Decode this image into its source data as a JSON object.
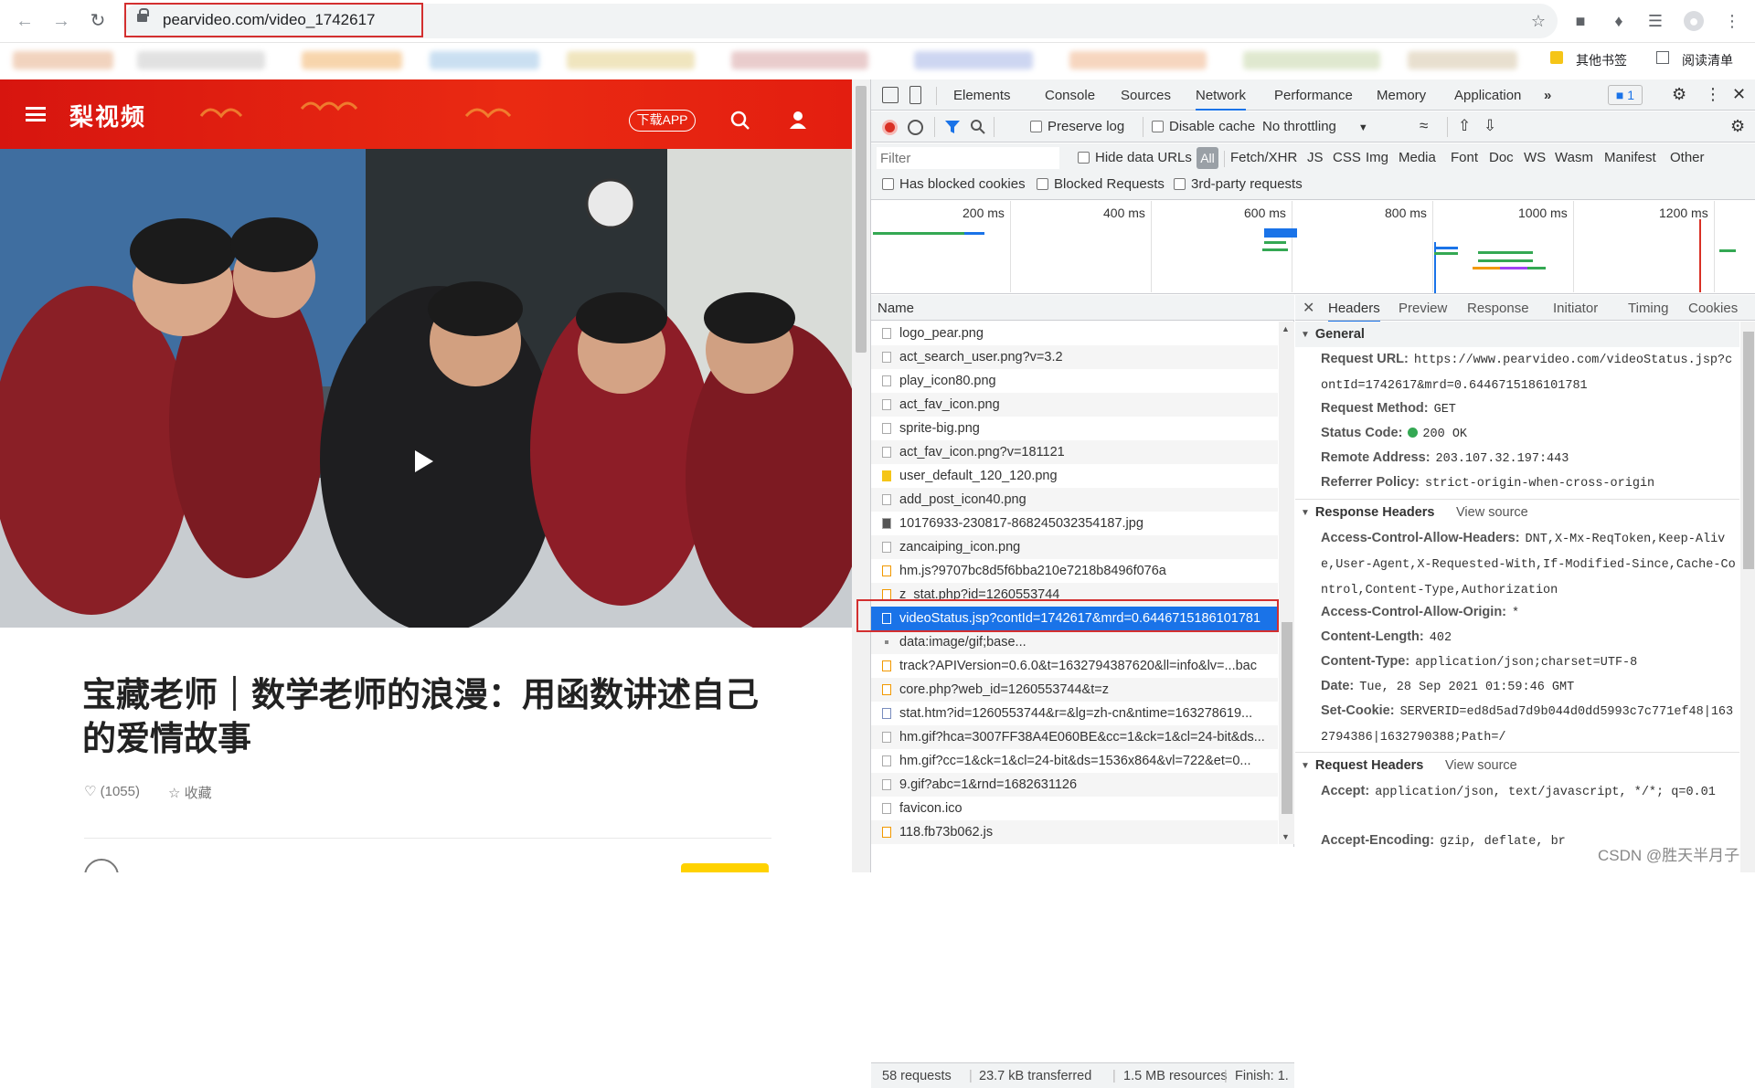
{
  "browser": {
    "url": "pearvideo.com/video_1742617",
    "bookmarks": {
      "other": "其他书签",
      "reading_list": "阅读清单"
    }
  },
  "site": {
    "logo": "梨视频",
    "download_app": "下载APP",
    "video_title": "宝藏老师｜数学老师的浪漫：用函数讲述自己的爱情故事",
    "likes": "(1055)",
    "favorite": "收藏"
  },
  "devtools": {
    "tabs": [
      "Elements",
      "Console",
      "Sources",
      "Network",
      "Performance",
      "Memory",
      "Application"
    ],
    "issues_count": "1",
    "toolbar": {
      "preserve_log": "Preserve log",
      "disable_cache": "Disable cache",
      "throttling": "No throttling"
    },
    "filter": {
      "placeholder": "Filter",
      "hide_data_urls": "Hide data URLs",
      "types": [
        "All",
        "Fetch/XHR",
        "JS",
        "CSS",
        "Img",
        "Media",
        "Font",
        "Doc",
        "WS",
        "Wasm",
        "Manifest",
        "Other"
      ],
      "has_blocked_cookies": "Has blocked cookies",
      "blocked_requests": "Blocked Requests",
      "third_party": "3rd-party requests"
    },
    "timeline_ticks": [
      "200 ms",
      "400 ms",
      "600 ms",
      "800 ms",
      "1000 ms",
      "1200 ms"
    ],
    "name_header": "Name",
    "requests": [
      "logo_pear.png",
      "act_search_user.png?v=3.2",
      "play_icon80.png",
      "act_fav_icon.png",
      "sprite-big.png",
      "act_fav_icon.png?v=181121",
      "user_default_120_120.png",
      "add_post_icon40.png",
      "10176933-230817-868245032354187.jpg",
      "zancaiping_icon.png",
      "hm.js?9707bc8d5f6bba210e7218b8496f076a",
      "z_stat.php?id=1260553744",
      "videoStatus.jsp?contId=1742617&mrd=0.6446715186101781",
      "data:image/gif;base...",
      "track?APIVersion=0.6.0&t=1632794387620&ll=info&lv=...bac",
      "core.php?web_id=1260553744&t=z",
      "stat.htm?id=1260553744&r=&lg=zh-cn&ntime=163278619...",
      "hm.gif?hca=3007FF38A4E060BE&cc=1&ck=1&cl=24-bit&ds...",
      "hm.gif?cc=1&ck=1&cl=24-bit&ds=1536x864&vl=722&et=0...",
      "9.gif?abc=1&rnd=1682631126",
      "favicon.ico",
      "118.fb73b062.js"
    ],
    "selected_request": "videoStatus.jsp?contId=1742617&mrd=0.6446715186101781",
    "status": {
      "requests": "58 requests",
      "transferred": "23.7 kB transferred",
      "resources": "1.5 MB resources",
      "finish": "Finish: 1."
    },
    "detail_tabs": [
      "Headers",
      "Preview",
      "Response",
      "Initiator",
      "Timing",
      "Cookies"
    ],
    "general": {
      "title": "General",
      "request_url_label": "Request URL:",
      "request_url": "https://www.pearvideo.com/videoStatus.jsp?contId=1742617&mrd=0.6446715186101781",
      "method_label": "Request Method:",
      "method": "GET",
      "status_label": "Status Code:",
      "status": "200 OK",
      "remote_label": "Remote Address:",
      "remote": "203.107.32.197:443",
      "referrer_label": "Referrer Policy:",
      "referrer": "strict-origin-when-cross-origin"
    },
    "response_headers": {
      "title": "Response Headers",
      "view_source": "View source",
      "items": [
        {
          "k": "Access-Control-Allow-Headers:",
          "v": "DNT,X-Mx-ReqToken,Keep-Alive,User-Agent,X-Requested-With,If-Modified-Since,Cache-Control,Content-Type,Authorization"
        },
        {
          "k": "Access-Control-Allow-Origin:",
          "v": "*"
        },
        {
          "k": "Content-Length:",
          "v": "402"
        },
        {
          "k": "Content-Type:",
          "v": "application/json;charset=UTF-8"
        },
        {
          "k": "Date:",
          "v": "Tue, 28 Sep 2021 01:59:46 GMT"
        },
        {
          "k": "Set-Cookie:",
          "v": "SERVERID=ed8d5ad7d9b044d0dd5993c7c771ef48|1632794386|1632790388;Path=/"
        }
      ]
    },
    "request_headers": {
      "title": "Request Headers",
      "view_source": "View source",
      "items": [
        {
          "k": "Accept:",
          "v": "application/json, text/javascript, */*; q=0.01"
        },
        {
          "k": "Accept-Encoding:",
          "v": "gzip, deflate, br"
        }
      ]
    }
  },
  "watermark": "CSDN @胜天半月子"
}
